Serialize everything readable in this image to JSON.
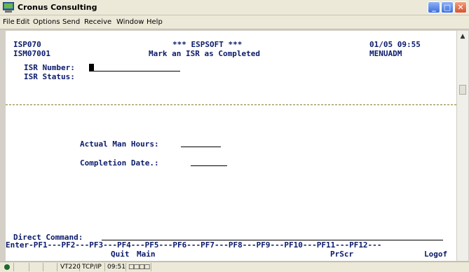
{
  "window": {
    "title": "Cronus Consulting",
    "app_icon": "terminal-icon",
    "controls": {
      "minimize": "minimize-icon",
      "maximize": "maximize-icon",
      "close": "close-icon"
    }
  },
  "menu": {
    "file": "File",
    "edit": "Edit",
    "options": "Options",
    "send": "Send",
    "receive": "Receive",
    "window": "Window",
    "help": "Help"
  },
  "screen": {
    "program_id": "ISP070",
    "screen_id": "ISM07001",
    "banner": "*** ESPSOFT ***",
    "subtitle": "Mark an ISR as Completed",
    "datetime": "01/05 09:55",
    "menu_id": "MENUADM",
    "isr_number_label": "ISR Number:",
    "isr_status_label": "ISR Status:",
    "actual_hours_label": "Actual Man Hours:",
    "completion_date_label": "Completion Date.:",
    "direct_command_label": "Direct Command:",
    "pf_keys": "Enter-PF1---PF2---PF3---PF4---PF5---PF6---PF7---PF8---PF9---PF10---PF11---PF12---",
    "pf3_label": "Quit",
    "pf4_label": "Main",
    "pf9_label": "PrScr",
    "pf12_label": "Logof"
  },
  "status_bar": {
    "terminal_type": "VT220",
    "protocol": "TCP/IP",
    "time": "09:51",
    "indicators": "□□□□"
  },
  "colors": {
    "titlebar_bg": "#ece9d8",
    "terminal_bg": "#ffffff",
    "text": "#000000",
    "separator": "#8a7a2a"
  }
}
